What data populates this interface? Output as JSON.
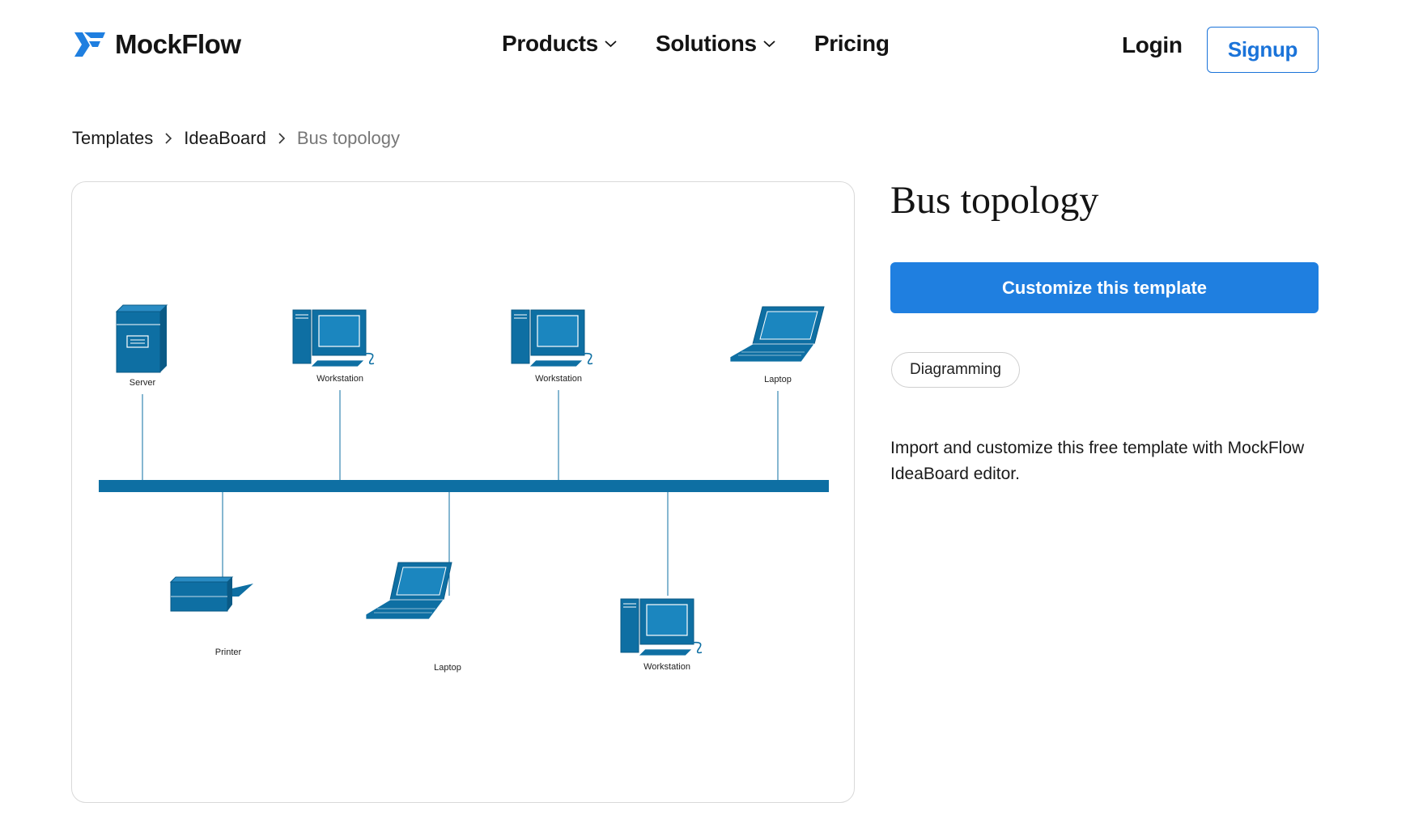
{
  "brand": {
    "name": "MockFlow",
    "accent": "#1f7fe0"
  },
  "nav": {
    "items": [
      {
        "label": "Products",
        "has_dropdown": true
      },
      {
        "label": "Solutions",
        "has_dropdown": true
      },
      {
        "label": "Pricing",
        "has_dropdown": false
      }
    ],
    "login_label": "Login",
    "signup_label": "Signup"
  },
  "breadcrumb": {
    "items": [
      "Templates",
      "IdeaBoard"
    ],
    "current": "Bus topology"
  },
  "template": {
    "title": "Bus topology",
    "cta_label": "Customize this template",
    "tag": "Diagramming",
    "description": "Import and customize this free template with MockFlow IdeaBoard editor."
  },
  "diagram": {
    "color": "#0e6fa3",
    "nodes": [
      {
        "type": "server",
        "label": "Server"
      },
      {
        "type": "workstation",
        "label": "Workstation"
      },
      {
        "type": "workstation",
        "label": "Workstation"
      },
      {
        "type": "laptop",
        "label": "Laptop"
      },
      {
        "type": "printer",
        "label": "Printer"
      },
      {
        "type": "laptop",
        "label": "Laptop"
      },
      {
        "type": "workstation",
        "label": "Workstation"
      }
    ]
  }
}
